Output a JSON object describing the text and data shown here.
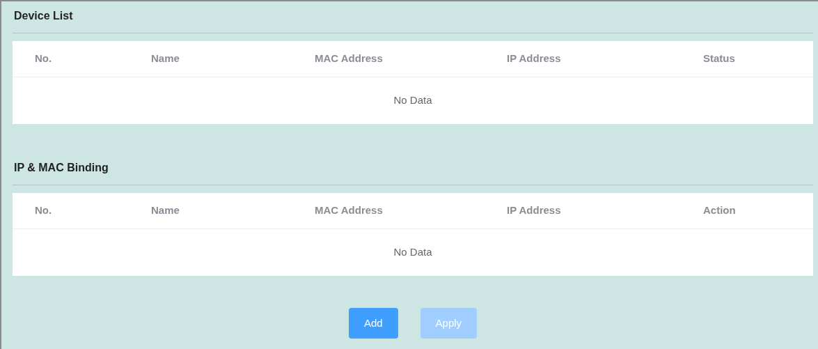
{
  "sections": [
    {
      "title": "Device List",
      "table": {
        "columns": [
          "No.",
          "Name",
          "MAC Address",
          "IP Address",
          "Status"
        ],
        "empty_text": "No Data"
      }
    },
    {
      "title": "IP & MAC Binding",
      "table": {
        "columns": [
          "No.",
          "Name",
          "MAC Address",
          "IP Address",
          "Action"
        ],
        "empty_text": "No Data"
      }
    }
  ],
  "buttons": [
    {
      "label": "Add",
      "disabled": false
    },
    {
      "label": "Apply",
      "disabled": true
    }
  ]
}
